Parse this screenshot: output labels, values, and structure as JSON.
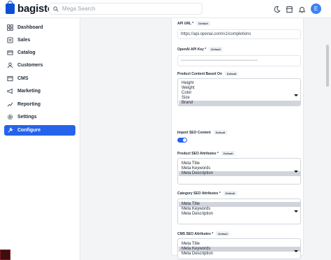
{
  "brand": {
    "name": "bagisto"
  },
  "search": {
    "placeholder": "Mega Search"
  },
  "header": {
    "avatar_letter": "E"
  },
  "sidebar": {
    "items": [
      {
        "label": "Dashboard",
        "icon": "dashboard-icon"
      },
      {
        "label": "Sales",
        "icon": "sales-icon"
      },
      {
        "label": "Catalog",
        "icon": "catalog-icon"
      },
      {
        "label": "Customers",
        "icon": "customers-icon"
      },
      {
        "label": "CMS",
        "icon": "cms-icon"
      },
      {
        "label": "Marketing",
        "icon": "marketing-icon"
      },
      {
        "label": "Reporting",
        "icon": "reporting-icon"
      },
      {
        "label": "Settings",
        "icon": "settings-icon"
      },
      {
        "label": "Configure",
        "icon": "configure-icon",
        "active": true
      }
    ]
  },
  "form": {
    "default_badge": "Default",
    "api_url": {
      "label": "API URL *",
      "value": "https://api.openai.com/v1/completions"
    },
    "api_key": {
      "label": "OpenAI API Key *",
      "value": "•••••••••••••••••••••••••••••••••••••••••••••••••"
    },
    "product_content": {
      "label": "Product Content Based On",
      "options": [
        "Height",
        "Weight",
        "Color",
        "Size",
        "Brand"
      ],
      "selected": [
        "Brand"
      ]
    },
    "import_seo": {
      "label": "Import SEO Content",
      "enabled": true
    },
    "product_seo": {
      "label": "Product SEO Attributes *",
      "options": [
        "Meta Title",
        "Meta Keywords",
        "Meta Description"
      ],
      "selected": [
        "Meta Description"
      ]
    },
    "category_seo": {
      "label": "Category SEO Attributes *",
      "options": [
        "Meta Title",
        "Meta Keywords",
        "Meta Description"
      ],
      "selected": [
        "Meta Title"
      ]
    },
    "cms_seo": {
      "label": "CMS SEO Attributes *",
      "options": [
        "Meta Title",
        "Meta Keywords",
        "Meta Description"
      ],
      "selected": [
        "Meta Keywords"
      ]
    }
  },
  "colors": {
    "accent": "#2563eb",
    "brand": "#0d4fd6"
  }
}
